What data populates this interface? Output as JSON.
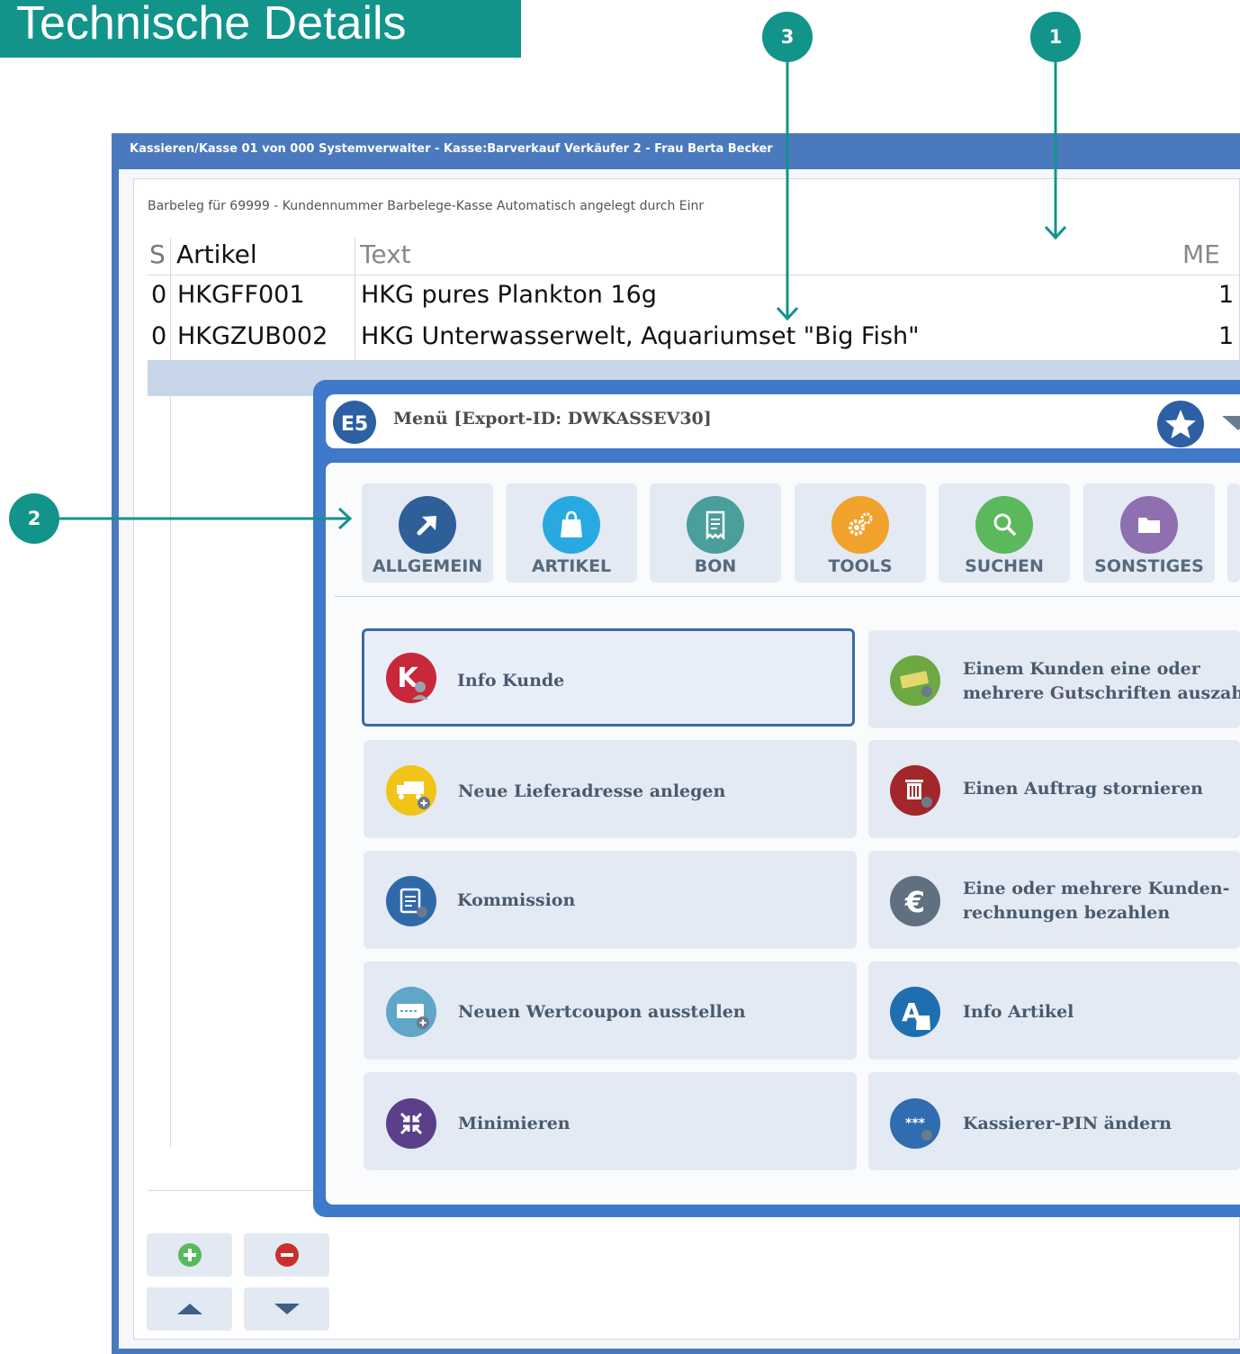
{
  "heading": "Technische Details",
  "callouts": [
    "1",
    "2",
    "3"
  ],
  "window": {
    "title": "Kassieren/Kasse 01 von 000 Systemverwalter - Kasse:Barverkauf Verkäufer 2 - Frau Berta Becker",
    "info_line": "Barbeleg für 69999 - Kundennummer Barbelege-Kasse Automatisch angelegt durch Einr"
  },
  "table": {
    "headers": {
      "s": "S",
      "artikel": "Artikel",
      "text": "Text",
      "me": "ME"
    },
    "rows": [
      {
        "s": "0",
        "artikel": "HKGFF001",
        "text": "HKG pures Plankton 16g",
        "me": "1"
      },
      {
        "s": "0",
        "artikel": "HKGZUB002",
        "text": "HKG Unterwasserwelt, Aquariumset \"Big Fish\"",
        "me": "1"
      }
    ]
  },
  "menu": {
    "title": "Menü [Export-ID: DWKASSEV30]",
    "tabs": [
      {
        "label": "ALLGEMEIN",
        "icon": "arrow-up-right-icon",
        "color": "#2e5f98"
      },
      {
        "label": "ARTIKEL",
        "icon": "shopping-bag-icon",
        "color": "#29a9e1"
      },
      {
        "label": "BON",
        "icon": "receipt-icon",
        "color": "#4a9e9b"
      },
      {
        "label": "TOOLS",
        "icon": "gears-icon",
        "color": "#f0a22c"
      },
      {
        "label": "SUCHEN",
        "icon": "search-icon",
        "color": "#5cb85c"
      },
      {
        "label": "SONSTIGES",
        "icon": "folder-icon",
        "color": "#8e6fb0"
      }
    ],
    "items": [
      {
        "label": "Info Kunde",
        "icon": "customer-info-icon",
        "color": "#c7283a"
      },
      {
        "label": "Einem Kunden eine oder mehrere Gutschriften auszahl",
        "line1": "Einem Kunden eine oder",
        "line2": "mehrere Gutschriften auszahl",
        "icon": "credit-note-icon",
        "color": "#6ea843"
      },
      {
        "label": "Neue Lieferadresse anlegen",
        "icon": "delivery-truck-icon",
        "color": "#f2c417"
      },
      {
        "label": "Einen Auftrag stornieren",
        "icon": "trash-icon",
        "color": "#a3262a"
      },
      {
        "label": "Kommission",
        "icon": "clipboard-icon",
        "color": "#2f69a8"
      },
      {
        "label": "Eine oder mehrere Kundenrechnungen bezahlen",
        "line1": "Eine oder mehrere Kunden-",
        "line2": "rechnungen bezahlen",
        "icon": "euro-icon",
        "color": "#5f7080"
      },
      {
        "label": "Neuen Wertcoupon ausstellen",
        "icon": "coupon-icon",
        "color": "#5fa6c9"
      },
      {
        "label": "Info Artikel",
        "icon": "article-info-icon",
        "color": "#1f6fb0"
      },
      {
        "label": "Minimieren",
        "icon": "minimize-icon",
        "color": "#5b3f8a"
      },
      {
        "label": "Kassierer-PIN ändern",
        "icon": "pin-icon",
        "color": "#2f6cb0"
      }
    ]
  },
  "colors": {
    "accent": "#12948b",
    "window": "#4a79bd",
    "menu_frame": "#3f79c9",
    "tile": "#e3eaf4"
  }
}
